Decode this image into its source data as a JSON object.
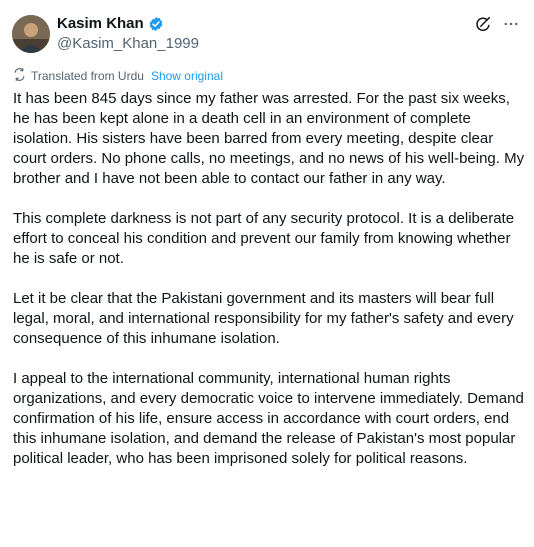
{
  "author": {
    "name": "Kasim Khan",
    "handle": "@Kasim_Khan_1999",
    "verified_color": "#1d9bf0"
  },
  "icons": {
    "verified": "verified-badge-icon",
    "grok": "grok-icon",
    "more": "more-icon",
    "translate": "translate-icon"
  },
  "translation": {
    "label": "Translated from Urdu",
    "show_original": "Show original"
  },
  "paragraphs": [
    "It has been 845 days since my father was arrested. For the past six weeks, he has been kept alone in a death cell in an environment of complete isolation. His sisters have been barred from every meeting, despite clear court orders. No phone calls, no meetings, and no news of his well-being. My brother and I have not been able to contact our father in any way.",
    "This complete darkness is not part of any security protocol. It is a deliberate effort to conceal his condition and prevent our family from knowing whether he is safe or not.",
    "Let it be clear that the Pakistani government and its masters will bear full legal, moral, and international responsibility for my father's safety and every consequence of this inhumane isolation.",
    "I appeal to the international community, international human rights organizations, and every democratic voice to intervene immediately. Demand confirmation of his life, ensure access in accordance with court orders, end this inhumane isolation, and demand the release of Pakistan's most popular political leader, who has been imprisoned solely for political reasons."
  ]
}
